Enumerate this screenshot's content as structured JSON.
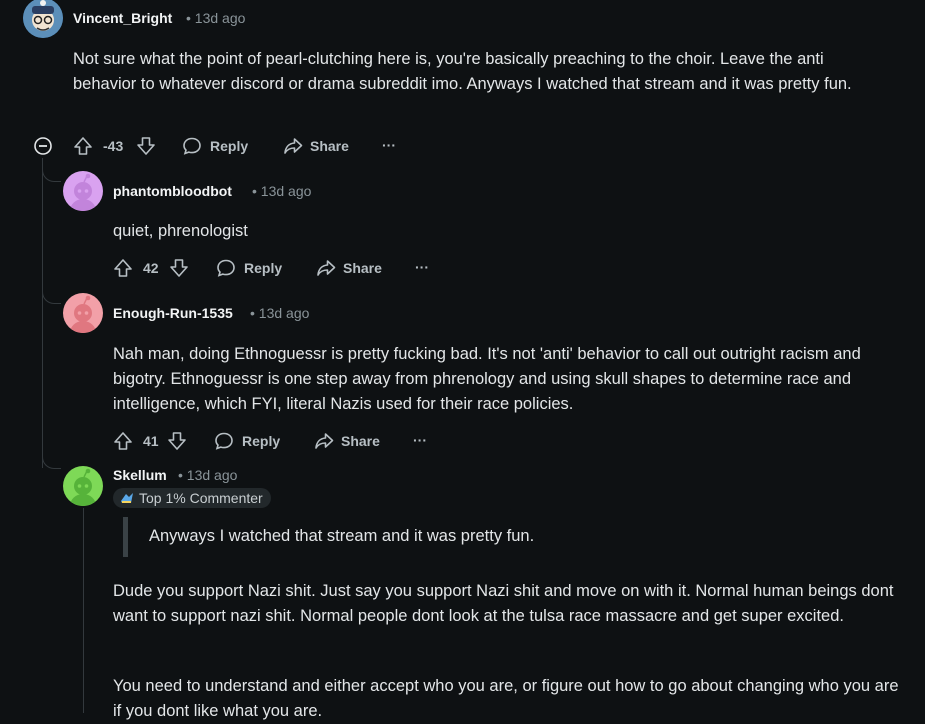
{
  "comments": [
    {
      "user": "Vincent_Bright",
      "time": "• 13d ago",
      "body": "Not sure what the point of pearl-clutching here is, you're basically preaching to the choir. Leave the anti behavior to whatever discord or drama subreddit imo. Anyways I watched that stream and it was pretty fun.",
      "score": "-43",
      "reply": "Reply",
      "share": "Share",
      "more": "···"
    },
    {
      "user": "phantombloodbot",
      "time": "• 13d ago",
      "body": "quiet, phrenologist",
      "score": "42",
      "reply": "Reply",
      "share": "Share",
      "more": "···"
    },
    {
      "user": "Enough-Run-1535",
      "time": "• 13d ago",
      "body": "Nah man, doing Ethnoguessr is pretty fucking bad. It's not 'anti' behavior to call out outright racism and bigotry. Ethnoguessr is one step away from phrenology and using skull shapes to determine race and intelligence, which FYI, literal Nazis used for their race policies.",
      "score": "41",
      "reply": "Reply",
      "share": "Share",
      "more": "···"
    },
    {
      "user": "Skellum",
      "time": "• 13d ago",
      "flair": "Top 1% Commenter",
      "quote": "Anyways I watched that stream and it was pretty fun.",
      "body1": "Dude you support Nazi shit. Just say you support Nazi shit and move on with it. Normal human beings dont want to support nazi shit. Normal people dont look at the tulsa race massacre and get super excited.",
      "body2": "You need to understand and either accept who you are, or figure out how to go about changing who you are if you dont like what you are."
    }
  ],
  "colors": {
    "background": "#0e1113",
    "avatar_phantom": "#d9a2f0",
    "avatar_enough": "#f2a0a8",
    "avatar_skellum": "#7ed957"
  }
}
